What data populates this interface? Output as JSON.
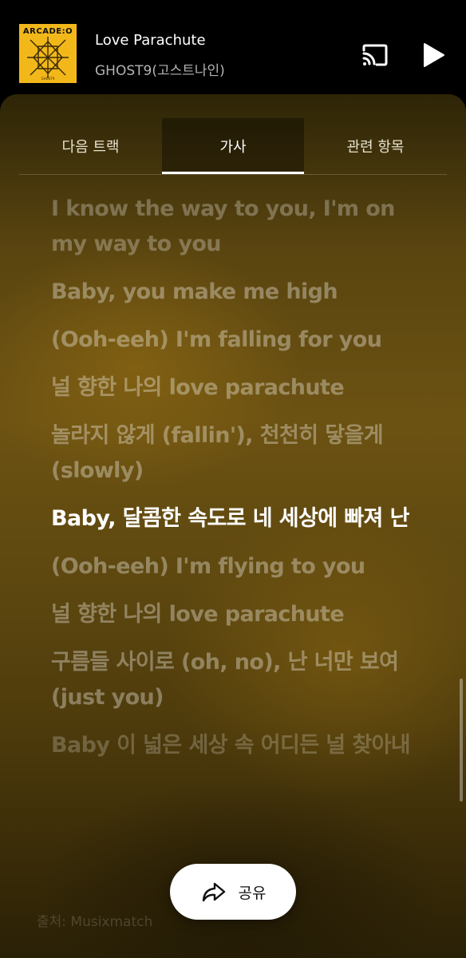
{
  "mini_player": {
    "album_art_text": "ARCADE:O",
    "title": "Love Parachute",
    "artist": "GHOST9(고스트나인)",
    "cast_icon": "cast-icon",
    "play_icon": "play-icon"
  },
  "tabs": [
    {
      "label": "다음 트랙",
      "active": false
    },
    {
      "label": "가사",
      "active": true
    },
    {
      "label": "관련 항목",
      "active": false
    }
  ],
  "lyrics": [
    {
      "text": "I know the way to you, I'm on my way to you",
      "current": false
    },
    {
      "text": "Baby, you make me high",
      "current": false
    },
    {
      "text": "(Ooh-eeh) I'm falling for you",
      "current": false
    },
    {
      "text": "널 향한 나의 love parachute",
      "current": false
    },
    {
      "text": "놀라지 않게 (fallin'), 천천히 닿을게 (slowly)",
      "current": false
    },
    {
      "text": "Baby, 달콤한 속도로 네 세상에 빠져 난",
      "current": true
    },
    {
      "text": "(Ooh-eeh) I'm flying to you",
      "current": false
    },
    {
      "text": "널 향한 나의 love parachute",
      "current": false
    },
    {
      "text": "구름들 사이로 (oh, no), 난 너만 보여 (just you)",
      "current": false
    },
    {
      "text": "Baby 이 넓은 세상 속 어디든 널 찾아내",
      "current": false
    }
  ],
  "source_text": "출처: Musixmatch",
  "share_button": {
    "label": "공유",
    "icon": "share-arrow-icon"
  },
  "colors": {
    "background": "#000000",
    "sheet_gradient_mid": "#6c5212",
    "current_lyric": "#ffffff",
    "album_art": "#f2b81a"
  }
}
